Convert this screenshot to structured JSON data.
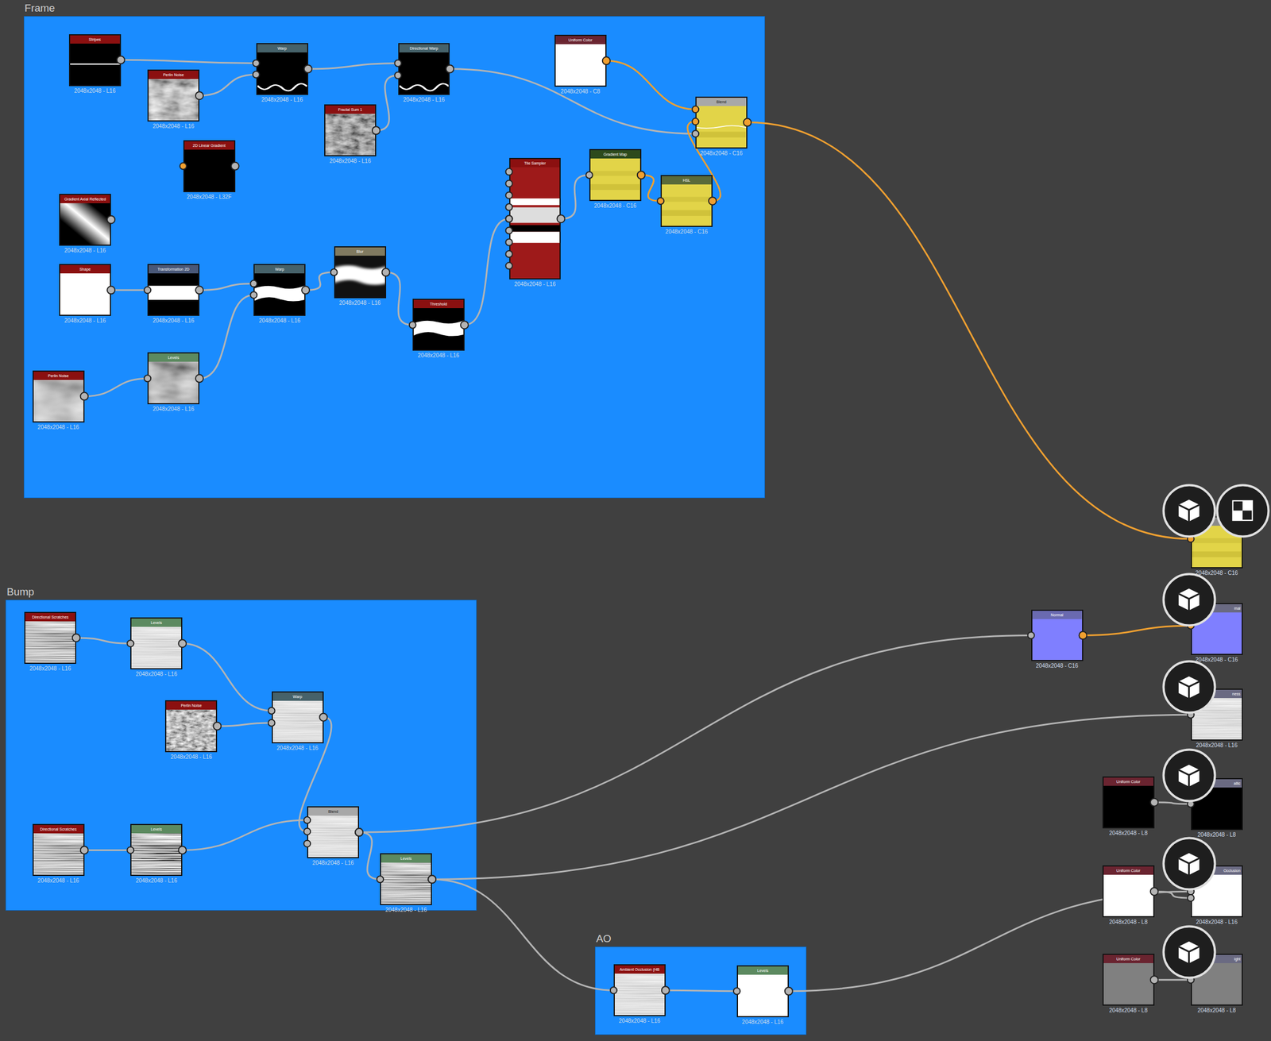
{
  "frames": [
    {
      "title": "Frame"
    },
    {
      "title": "Bump"
    },
    {
      "title": "AO"
    }
  ],
  "nodes": [
    {
      "title": "Stripes",
      "resolution": "2048x2048 - L16",
      "color": "#8b1010"
    },
    {
      "title": "Perlin Noise",
      "resolution": "2048x2048 - L16",
      "color": "#8b1010"
    },
    {
      "title": "Warp",
      "resolution": "2048x2048 - L16",
      "color": "#46626a"
    },
    {
      "title": "Directional Warp",
      "resolution": "2048x2048 - L16",
      "color": "#46626a"
    },
    {
      "title": "Fractal Sum 1",
      "resolution": "2048x2048 - L16",
      "color": "#8b1010"
    },
    {
      "title": "Uniform Color",
      "resolution": "2048x2048 - C8",
      "color": "#6a2430"
    },
    {
      "title": "Blend",
      "resolution": "2048x2048 - C16",
      "color": "#a8a8a8"
    },
    {
      "title": "2D Linear Gradient",
      "resolution": "2048x2048 - L32F",
      "color": "#8b1010"
    },
    {
      "title": "Gradient Axial Reflected",
      "resolution": "2048x2048 - L16",
      "color": "#8b1010"
    },
    {
      "title": "Tile Sampler",
      "resolution": "2048x2048 - L16",
      "color": "#8b1010"
    },
    {
      "title": "Gradient Map",
      "resolution": "2048x2048 - C16",
      "color": "#2d4a1c"
    },
    {
      "title": "HSL",
      "resolution": "2048x2048 - C16",
      "color": "#5a6a3a"
    },
    {
      "title": "Shape",
      "resolution": "2048x2048 - L16",
      "color": "#8b1010"
    },
    {
      "title": "Transformation 2D",
      "resolution": "2048x2048 - L16",
      "color": "#4a5878"
    },
    {
      "title": "Warp",
      "resolution": "2048x2048 - L16",
      "color": "#46626a"
    },
    {
      "title": "Blur",
      "resolution": "2048x2048 - L16",
      "color": "#807a60"
    },
    {
      "title": "Threshold",
      "resolution": "2048x2048 - L16",
      "color": "#8b1010"
    },
    {
      "title": "Perlin Noise",
      "resolution": "2048x2048 - L16",
      "color": "#8b1010"
    },
    {
      "title": "Levels",
      "resolution": "2048x2048 - L16",
      "color": "#5c8a60"
    },
    {
      "title": "Directional Scratches",
      "resolution": "2048x2048 - L16",
      "color": "#8b1010"
    },
    {
      "title": "Levels",
      "resolution": "2048x2048 - L16",
      "color": "#5c8a60"
    },
    {
      "title": "Perlin Noise",
      "resolution": "2048x2048 - L16",
      "color": "#8b1010"
    },
    {
      "title": "Warp",
      "resolution": "2048x2048 - L16",
      "color": "#46626a"
    },
    {
      "title": "Directional Scratches",
      "resolution": "2048x2048 - L16",
      "color": "#8b1010"
    },
    {
      "title": "Levels",
      "resolution": "2048x2048 - L16",
      "color": "#5c8a60"
    },
    {
      "title": "Blend",
      "resolution": "2048x2048 - L16",
      "color": "#a8a8a8"
    },
    {
      "title": "Levels",
      "resolution": "2048x2048 - L16",
      "color": "#5c8a60"
    },
    {
      "title": "Ambient Occlusion (HB",
      "resolution": "2048x2048 - L16",
      "color": "#8b1010"
    },
    {
      "title": "Levels",
      "resolution": "2048x2048 - L16",
      "color": "#5c8a60"
    },
    {
      "title": "Normal",
      "resolution": "2048x2048 - C16",
      "color": "#6a6ab0"
    },
    {
      "title": "",
      "resolution": "2048x2048 - C16",
      "color": "#8a8a8a"
    },
    {
      "title": "mal",
      "resolution": "2048x2048 - C16",
      "color": "#6a6a82"
    },
    {
      "title": "ness",
      "resolution": "2048x2048 - L16",
      "color": "#6a6a82"
    },
    {
      "title": "Uniform Color",
      "resolution": "2048x2048 - L8",
      "color": "#6a2430"
    },
    {
      "title": "allic",
      "resolution": "2048x2048 - L8",
      "color": "#6a6a82"
    },
    {
      "title": "Uniform Color",
      "resolution": "2048x2048 - L8",
      "color": "#6a2430"
    },
    {
      "title": "Occlusion",
      "resolution": "2048x2048 - L16",
      "color": "#6a6a82"
    },
    {
      "title": "Uniform Color",
      "resolution": "2048x2048 - L8",
      "color": "#6a2430"
    },
    {
      "title": "ight",
      "resolution": "2048x2048 - L8",
      "color": "#6a6a82"
    }
  ],
  "viewport_icons": [
    {
      "kind": "cube"
    },
    {
      "kind": "checker"
    },
    {
      "kind": "cube"
    },
    {
      "kind": "cube"
    },
    {
      "kind": "cube"
    },
    {
      "kind": "cube"
    },
    {
      "kind": "cube"
    }
  ]
}
